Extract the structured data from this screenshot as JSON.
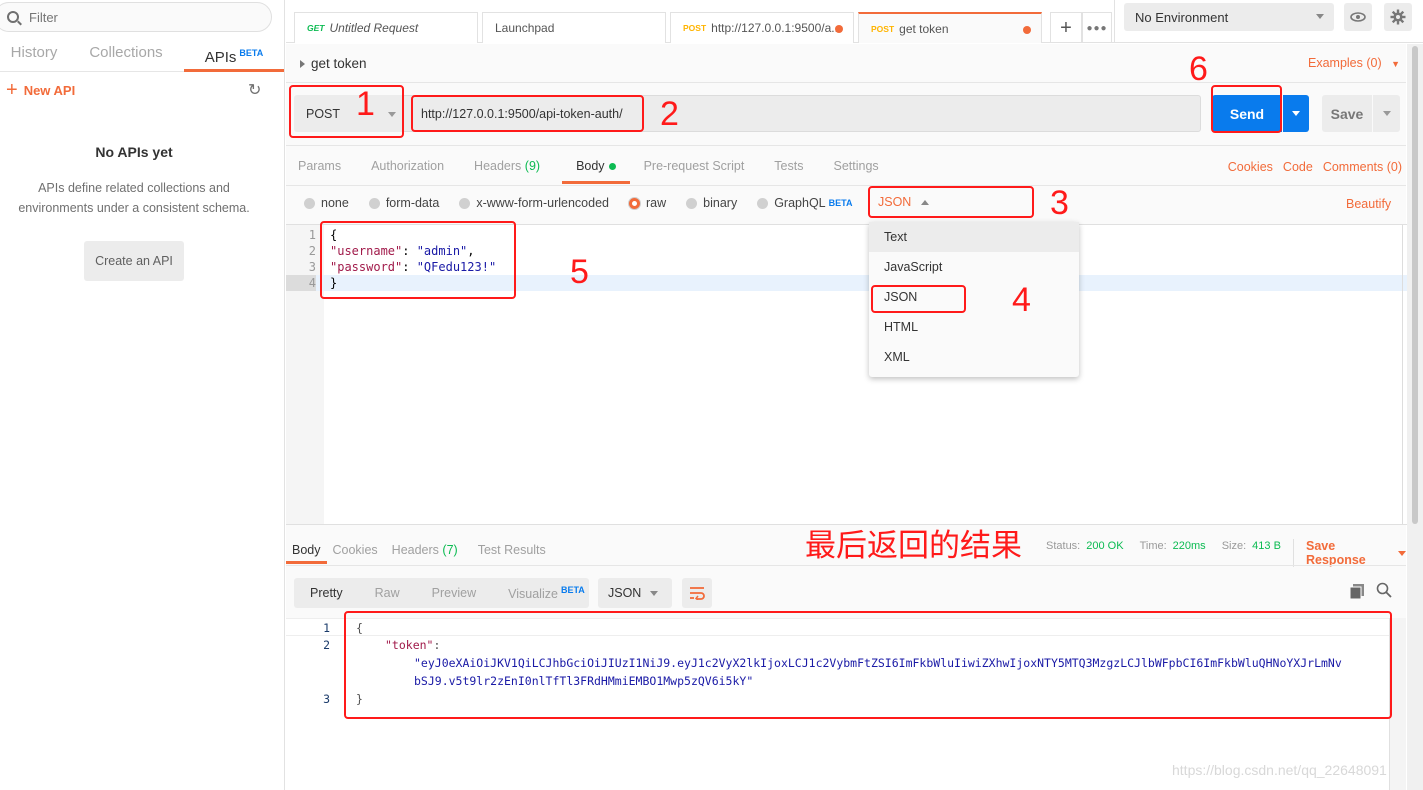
{
  "sidebar": {
    "filter_placeholder": "Filter",
    "tabs": [
      {
        "label": "History"
      },
      {
        "label": "Collections"
      },
      {
        "label": "APIs",
        "badge": "BETA"
      }
    ],
    "new_api_label": "New API",
    "empty_title": "No APIs yet",
    "empty_desc": "APIs define related collections and environments under a consistent schema.",
    "create_button": "Create an API"
  },
  "tabs": [
    {
      "method": "GET",
      "label": "Untitled Request"
    },
    {
      "method": "",
      "label": "Launchpad"
    },
    {
      "method": "POST",
      "label": "http://127.0.0.1:9500/a...",
      "unsaved": true
    },
    {
      "method": "POST",
      "label": "get token",
      "unsaved": true,
      "active": true
    }
  ],
  "environment": {
    "selected": "No Environment"
  },
  "request": {
    "name": "get token",
    "examples_label": "Examples (0)",
    "method": "POST",
    "url": "http://127.0.0.1:9500/api-token-auth/",
    "send_label": "Send",
    "save_label": "Save",
    "tabs": [
      {
        "label": "Params"
      },
      {
        "label": "Authorization"
      },
      {
        "label": "Headers",
        "count": "(9)"
      },
      {
        "label": "Body",
        "active": true
      },
      {
        "label": "Pre-request Script"
      },
      {
        "label": "Tests"
      },
      {
        "label": "Settings"
      }
    ],
    "links": [
      "Cookies",
      "Code",
      "Comments (0)"
    ],
    "body_types": [
      "none",
      "form-data",
      "x-www-form-urlencoded",
      "raw",
      "binary",
      "GraphQL"
    ],
    "body_type_selected": "raw",
    "graphql_badge": "BETA",
    "language": "JSON",
    "beautify_label": "Beautify",
    "language_options": [
      "Text",
      "JavaScript",
      "JSON",
      "HTML",
      "XML"
    ],
    "body_lines": [
      {
        "n": "1",
        "text": "{"
      },
      {
        "n": "2",
        "key": "\"username\"",
        "sep": ": ",
        "val": "\"admin\"",
        "end": ","
      },
      {
        "n": "3",
        "key": "\"password\"",
        "sep": ": ",
        "val": "\"QFedu123!\"",
        "end": ""
      },
      {
        "n": "4",
        "text": "}"
      }
    ]
  },
  "response": {
    "tabs": [
      {
        "label": "Body",
        "active": true
      },
      {
        "label": "Cookies"
      },
      {
        "label": "Headers",
        "count": "(7)"
      },
      {
        "label": "Test Results"
      }
    ],
    "status_label": "Status:",
    "status": "200 OK",
    "time_label": "Time:",
    "time": "220ms",
    "size_label": "Size:",
    "size": "413 B",
    "save_response_label": "Save Response",
    "view_modes": [
      "Pretty",
      "Raw",
      "Preview",
      "Visualize"
    ],
    "visualize_badge": "BETA",
    "format": "JSON",
    "lines": [
      {
        "n": "1",
        "text": "{"
      },
      {
        "n": "2",
        "key": "\"token\"",
        "sep": ":"
      },
      {
        "n": "",
        "val": "\"eyJ0eXAiOiJKV1QiLCJhbGciOiJIUzI1NiJ9.eyJ1c2VyX2lkIjoxLCJ1c2VybmFtZSI6ImFkbWluIiwiZXhwIjoxNTY5MTQ3MzgzLCJlbWFpbCI6ImFkbWluQHNoYXJrLmNv"
      },
      {
        "n": "",
        "val": "bSJ9.v5t9lr2zEnI0nlTfTl3FRdHMmiEMBO1Mwp5zQV6i5kY\""
      },
      {
        "n": "3",
        "text": "}"
      }
    ]
  },
  "annotations": {
    "numbers": [
      "1",
      "2",
      "3",
      "4",
      "5",
      "6"
    ],
    "result_caption": "最后返回的结果",
    "color": "#ff1a1a"
  },
  "watermark": "https://blog.csdn.net/qq_22648091",
  "colors": {
    "accent": "#f26b3a",
    "primary": "#097bed",
    "success": "#0cbb52",
    "post": "#ffb400",
    "get": "#0cbb52"
  }
}
